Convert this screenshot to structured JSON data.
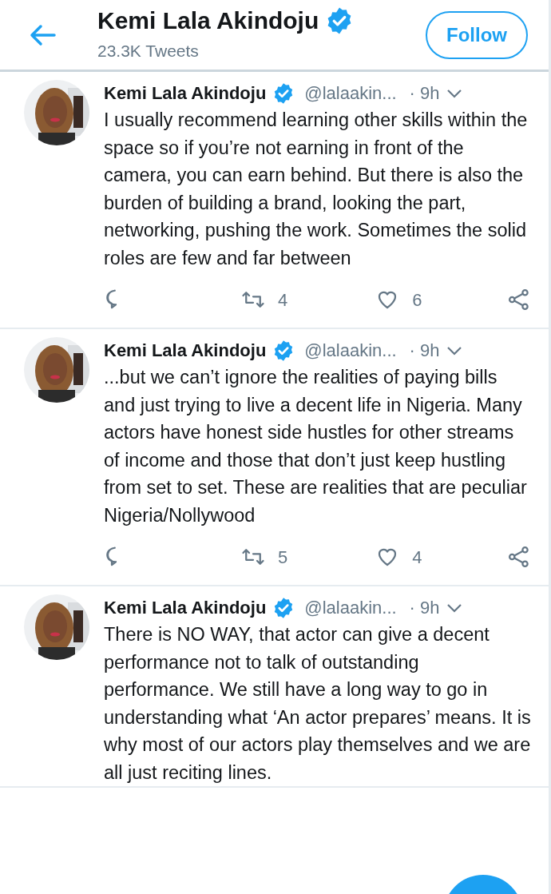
{
  "header": {
    "name": "Kemi Lala Akindoju",
    "verified": true,
    "tweet_count": "23.3K Tweets",
    "follow_button": "Follow"
  },
  "tweets": [
    {
      "name": "Kemi Lala Akindoju",
      "verified": true,
      "handle": "@lalaakin...",
      "time": "· 9h",
      "text": "I usually recommend learning other skills within the space so if you’re not earning in front of the camera, you can earn behind. But there is also the burden of building a brand, looking the part, networking, pushing the work. Sometimes the solid roles are few and far between",
      "retweets": "4",
      "likes": "6"
    },
    {
      "name": "Kemi Lala Akindoju",
      "verified": true,
      "handle": "@lalaakin...",
      "time": "· 9h",
      "text": "...but we can’t ignore the realities of paying bills and just trying to live a decent life in Nigeria. Many actors have honest side hustles for other streams of income and those that don’t just keep hustling from set to set. These are realities that are peculiar Nigeria/Nollywood",
      "retweets": "5",
      "likes": "4"
    },
    {
      "name": "Kemi Lala Akindoju",
      "verified": true,
      "handle": "@lalaakin...",
      "time": "· 9h",
      "text": "There is NO WAY, that actor can give a decent performance not to talk of outstanding performance. We still have a long way to go in understanding what ‘An actor prepares’ means. It is why most of our actors play themselves and we are all just reciting lines."
    }
  ]
}
